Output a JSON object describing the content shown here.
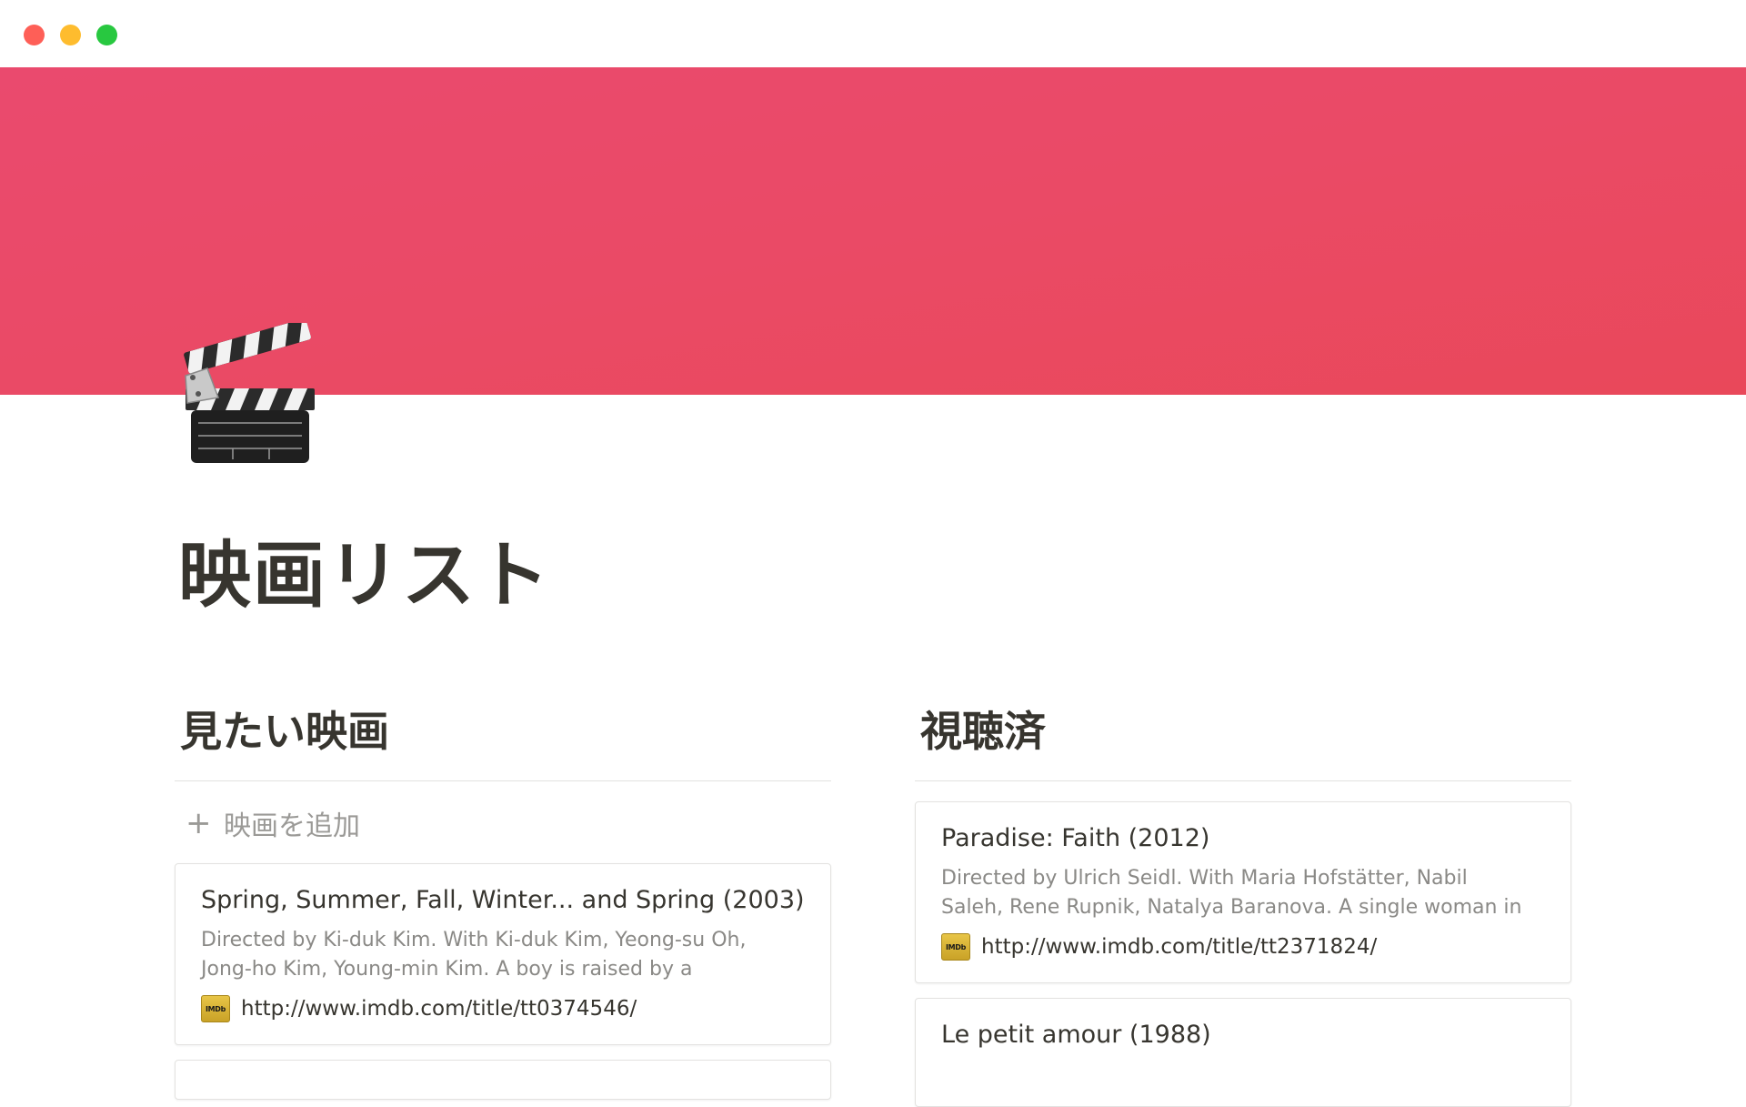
{
  "window": {
    "controls": [
      "close",
      "minimize",
      "zoom"
    ]
  },
  "page": {
    "icon": "clapper-board-icon",
    "title": "映画リスト"
  },
  "columns": {
    "want": {
      "heading": "見たい映画",
      "add_label": "映画を追加",
      "add_icon": "plus-icon",
      "cards": [
        {
          "title": "Spring, Summer, Fall, Winter... and Spring (2003)",
          "desc_line1": "Directed by Ki-duk Kim. With Ki-duk Kim, Yeong-su Oh,",
          "desc_line2": "Jong-ho Kim, Young-min Kim. A boy is raised by a",
          "url": "http://www.imdb.com/title/tt0374546/",
          "link_icon": "imdb-icon",
          "link_icon_text": "IMDb"
        }
      ]
    },
    "watched": {
      "heading": "視聴済",
      "cards": [
        {
          "title": "Paradise: Faith (2012)",
          "desc_line1": "Directed by Ulrich Seidl. With Maria Hofstätter, Nabil",
          "desc_line2": "Saleh, Rene Rupnik, Natalya Baranova. A single woman in",
          "url": "http://www.imdb.com/title/tt2371824/",
          "link_icon": "imdb-icon",
          "link_icon_text": "IMDb"
        },
        {
          "title": "Le petit amour (1988)"
        }
      ]
    }
  },
  "colors": {
    "cover_top": "#ea4a6e",
    "cover_bottom": "#e9485a",
    "text": "#37352f",
    "muted": "#8a8986"
  }
}
